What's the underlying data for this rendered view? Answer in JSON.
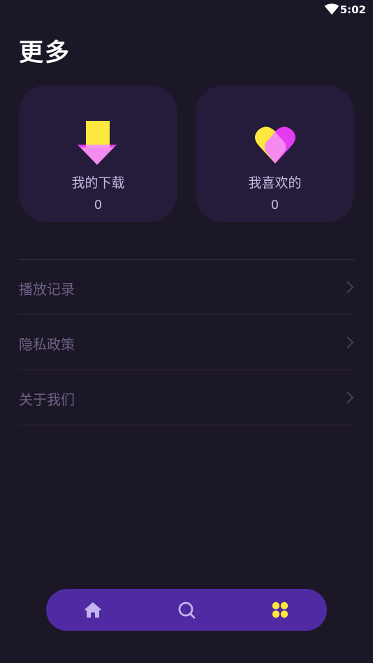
{
  "status_bar": {
    "time": "5:02",
    "wifi_icon": "wifi-icon"
  },
  "header": {
    "title": "更多"
  },
  "cards": [
    {
      "label": "我的下载",
      "count": "0",
      "icon": "download-arrow-icon"
    },
    {
      "label": "我喜欢的",
      "count": "0",
      "icon": "heart-icon"
    }
  ],
  "menu": [
    {
      "label": "播放记录",
      "icon": "chevron-right-icon"
    },
    {
      "label": "隐私政策",
      "icon": "chevron-right-icon"
    },
    {
      "label": "关于我们",
      "icon": "chevron-right-icon"
    }
  ],
  "bottom_nav": [
    {
      "name": "home",
      "icon": "home-icon",
      "active": false
    },
    {
      "name": "search",
      "icon": "search-icon",
      "active": false
    },
    {
      "name": "more",
      "icon": "grid-icon",
      "active": true
    }
  ],
  "colors": {
    "background": "#1c1727",
    "card": "#251c3b",
    "nav_bar": "#4f2aa3",
    "accent_yellow": "#fde93e",
    "accent_pink": "#f58bf0",
    "accent_magenta": "#e43cf0",
    "nav_icon": "#c4b3ef",
    "menu_text": "#6b6286"
  }
}
